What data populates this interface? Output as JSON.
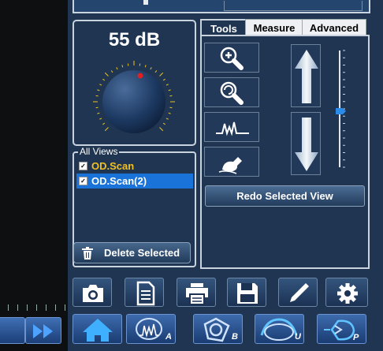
{
  "gain": {
    "value": "55 dB",
    "level": 0.55
  },
  "views": {
    "legend": "All Views",
    "items": [
      {
        "label": "OD.Scan",
        "checked": true,
        "selected": false
      },
      {
        "label": "OD.Scan(2)",
        "checked": true,
        "selected": true
      }
    ],
    "delete_label": "Delete Selected"
  },
  "tools": {
    "tabs": [
      "Tools",
      "Measure",
      "Advanced"
    ],
    "active_tab": "Tools",
    "buttons": [
      "zoom-in-icon",
      "zoom-reset-icon",
      "waveform-icon",
      "erase-icon"
    ],
    "redo_label": "Redo Selected View",
    "slider_level": 0.48
  },
  "toolbar": {
    "icons": [
      "camera-icon",
      "document-icon",
      "printer-icon",
      "save-icon",
      "pen-icon",
      "gear-icon"
    ]
  },
  "modes": [
    {
      "icon": "home-icon",
      "sub": ""
    },
    {
      "icon": "a-scan-icon",
      "sub": "A"
    },
    {
      "icon": "b-scan-icon",
      "sub": "B"
    },
    {
      "icon": "ubm-icon",
      "sub": "U"
    },
    {
      "icon": "pachymetry-icon",
      "sub": "P"
    }
  ],
  "colors": {
    "accent": "#1a73d8",
    "unselected_view": "#f0c020",
    "knob_marker": "#e02020"
  }
}
